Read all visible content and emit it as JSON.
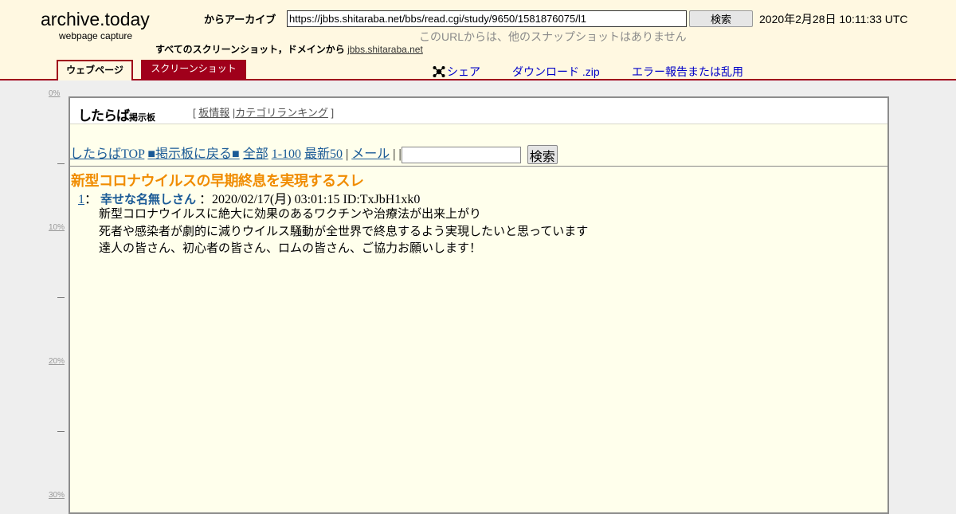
{
  "archive": {
    "brand": "archive.today",
    "brand_sub": "webpage capture",
    "archive_label": "からアーカイブ",
    "url_value": "https://jbbs.shitaraba.net/bbs/read.cgi/study/9650/1581876075/l1",
    "search_button": "検索",
    "capture_date": "2020年2月28日 10:11:33 UTC",
    "no_snapshots": "このURLからは、他のスナップショットはありません",
    "all_shots_label": "すべてのスクリーンショット，ドメインから",
    "domain_link": "jbbs.shitaraba.net",
    "tabs": {
      "webpage": "ウェブページ",
      "screenshot": "スクリーンショット"
    },
    "actions": {
      "share": "シェア",
      "download": "ダウンロード .zip",
      "report": "エラー報告または乱用"
    },
    "accent_color": "#a0001b"
  },
  "ruler": {
    "labels": [
      "0%",
      "10%",
      "20%",
      "30%"
    ]
  },
  "page": {
    "logo": "したらば",
    "logo_small": "掲示板",
    "top_links": {
      "open": "[",
      "board_info": "板情報",
      "bar": "|",
      "ranking": "カテゴリランキング",
      "close": "]"
    },
    "nav": {
      "top": "したらばTOP",
      "back": "■掲示板に戻る■",
      "all": "全部",
      "range": "1-100",
      "latest": "最新50",
      "sep1": "|",
      "mail": "メール",
      "sep2": "| |",
      "search_button": "検索"
    },
    "thread_title": "新型コロナウイルスの早期終息を実現するスレ",
    "post": {
      "number": "1",
      "colon": "：",
      "name": "幸せな名無しさん",
      "meta": "：2020/02/17(月) 03:01:15 ID:TxJbH1xk0",
      "lines": [
        "新型コロナウイルスに絶大に効果のあるワクチンや治療法が出来上がり",
        "死者や感染者が劇的に減りウイルス騒動が全世界で終息するよう実現したいと思っています",
        "達人の皆さん、初心者の皆さん、ロムの皆さん、ご協力お願いします！"
      ]
    },
    "title_color": "#f08c00",
    "background_color": "#ffffec"
  }
}
